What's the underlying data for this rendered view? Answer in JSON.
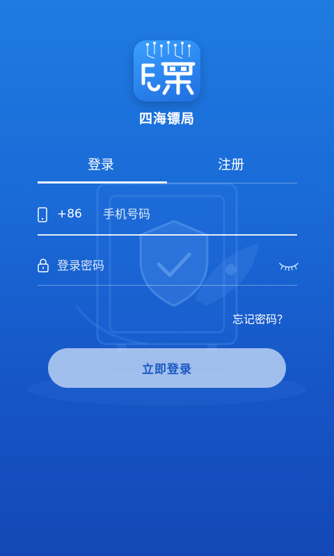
{
  "app": {
    "name": "四海镖局"
  },
  "tabs": {
    "login_label": "登录",
    "register_label": "注册"
  },
  "phone_field": {
    "country_code": "+86",
    "placeholder": "手机号码"
  },
  "password_field": {
    "placeholder": "登录密码"
  },
  "forgot_password_label": "忘记密码？",
  "login_button_label": "立即登录",
  "colors": {
    "background_top": "#1f7be0",
    "background_bottom": "#1448b6",
    "button_text": "#1b58c4",
    "button_bg": "#d5e6fa"
  },
  "icons": {
    "phone": "phone-icon",
    "lock": "lock-icon",
    "eye": "eye-closed-icon",
    "logo": "app-logo-icon"
  }
}
